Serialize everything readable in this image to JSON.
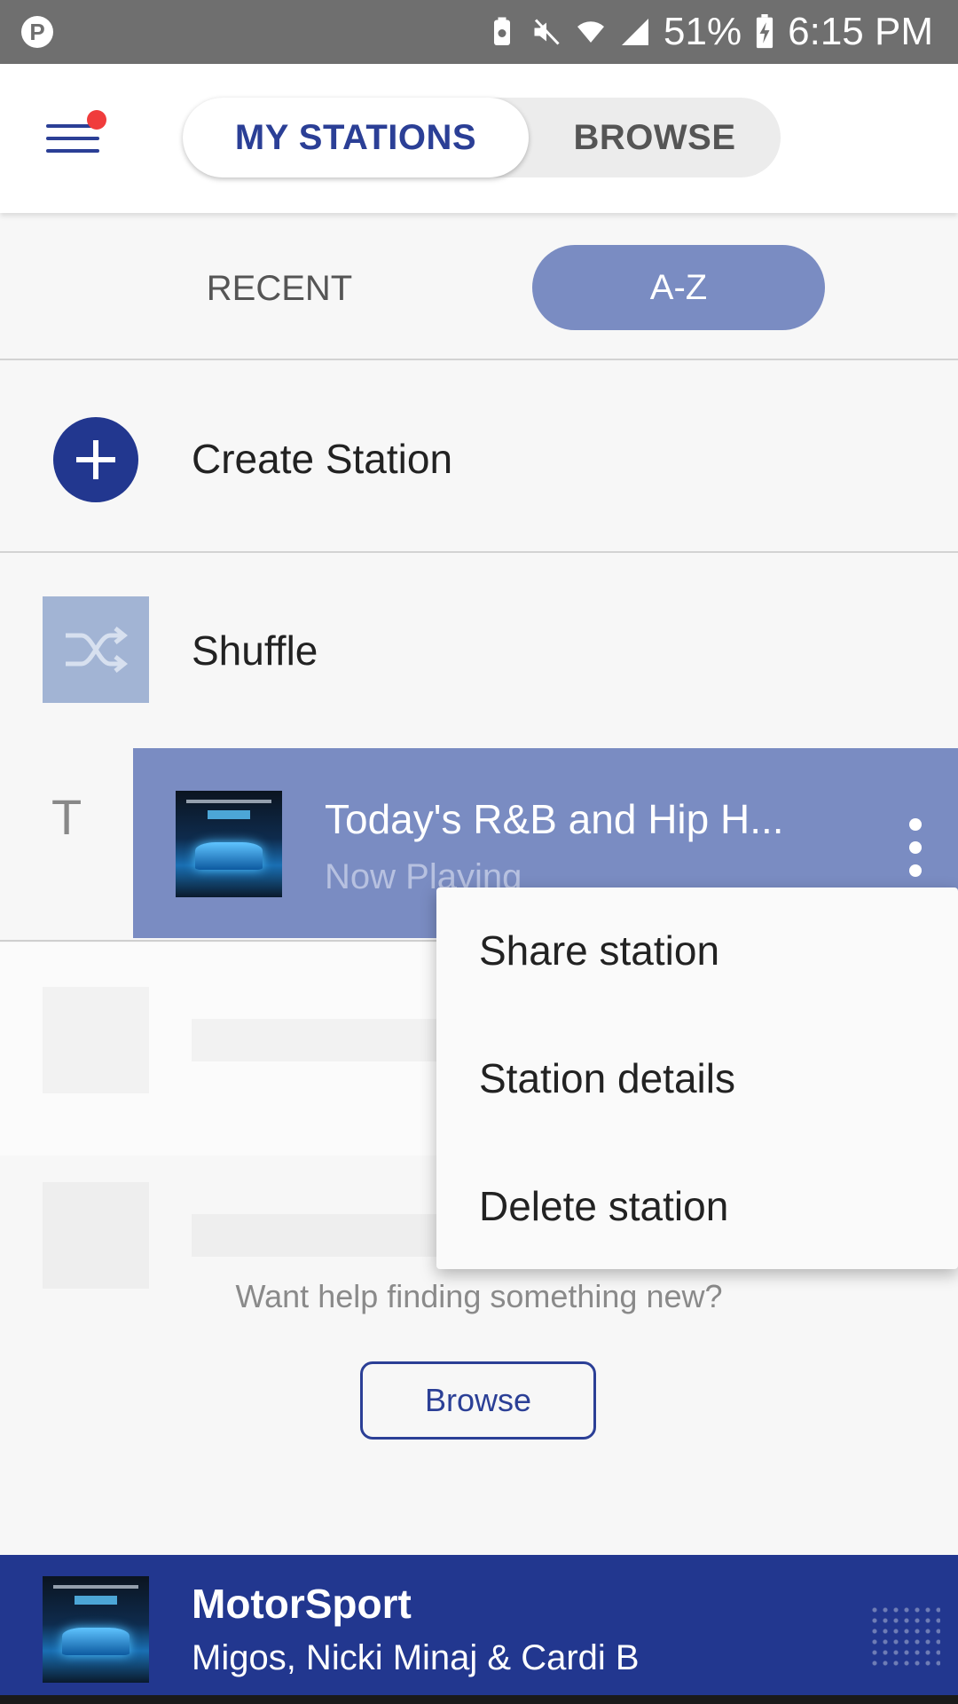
{
  "status_bar": {
    "battery_percent": "51%",
    "time": "6:15 PM",
    "icons": [
      "pandora-app-icon",
      "battery-saver-icon",
      "mute-icon",
      "wifi-icon",
      "signal-icon",
      "battery-charging-icon"
    ]
  },
  "header": {
    "tabs": [
      {
        "label": "MY STATIONS",
        "active": true
      },
      {
        "label": "BROWSE",
        "active": false
      }
    ]
  },
  "sort": {
    "options": [
      {
        "label": "RECENT",
        "active": false
      },
      {
        "label": "A-Z",
        "active": true
      }
    ]
  },
  "list": {
    "create_label": "Create Station",
    "shuffle_label": "Shuffle",
    "section_letter": "T",
    "selected_station": {
      "title": "Today's R&B and Hip H...",
      "subtitle": "Now Playing"
    }
  },
  "context_menu": {
    "items": [
      "Share station",
      "Station details",
      "Delete station"
    ]
  },
  "empty_state": {
    "help_text": "Want help finding something new?",
    "browse_label": "Browse"
  },
  "now_playing": {
    "title": "MotorSport",
    "artist": "Migos, Nicki Minaj & Cardi B"
  },
  "colors": {
    "brand": "#22378f",
    "accent_selected": "#7a8cc2",
    "notification_dot": "#f03c3c"
  }
}
